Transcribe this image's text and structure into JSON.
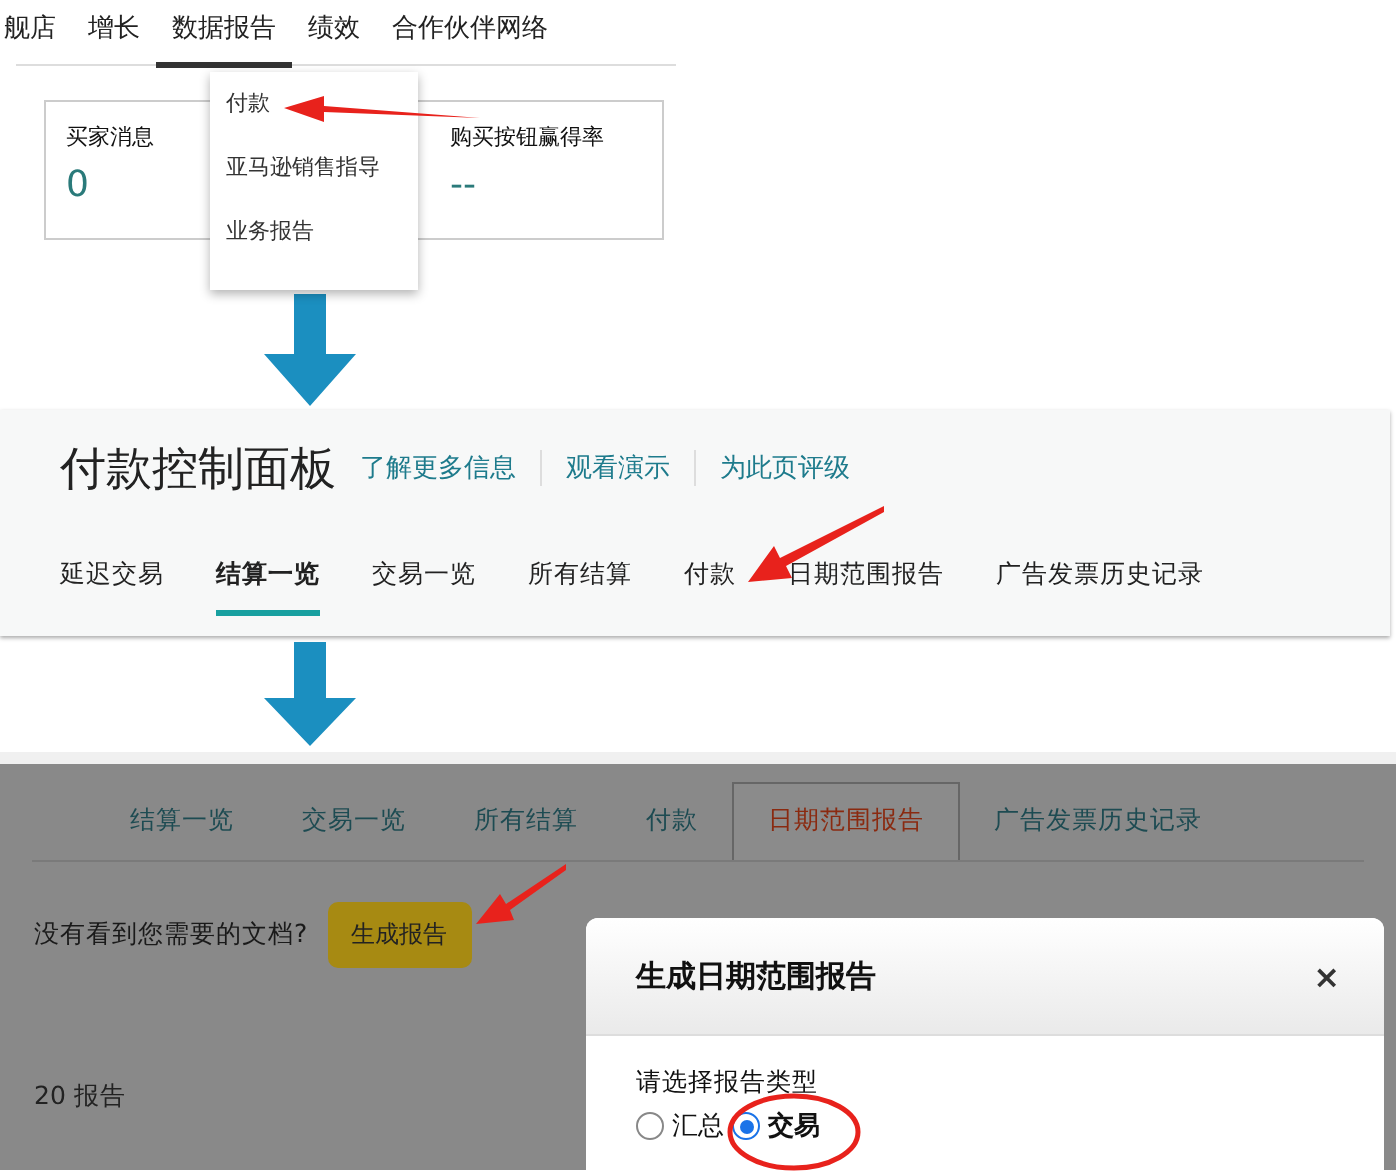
{
  "top_nav": {
    "items": [
      {
        "label": "舰店",
        "selected": false
      },
      {
        "label": "增长",
        "selected": false
      },
      {
        "label": "数据报告",
        "selected": true
      },
      {
        "label": "绩效",
        "selected": false
      },
      {
        "label": "合作伙伴网络",
        "selected": false
      }
    ],
    "dropdown": [
      "付款",
      "亚马逊销售指导",
      "业务报告"
    ],
    "cards": [
      {
        "label": "买家消息",
        "value": "0"
      },
      {
        "label": "购买按钮赢得率",
        "value": "--"
      }
    ]
  },
  "payments_dashboard": {
    "title": "付款控制面板",
    "links": [
      "了解更多信息",
      "观看演示",
      "为此页评级"
    ],
    "tabs": [
      {
        "label": "延迟交易",
        "selected": false
      },
      {
        "label": "结算一览",
        "selected": true
      },
      {
        "label": "交易一览",
        "selected": false
      },
      {
        "label": "所有结算",
        "selected": false
      },
      {
        "label": "付款",
        "selected": false
      },
      {
        "label": "日期范围报告",
        "selected": false
      },
      {
        "label": "广告发票历史记录",
        "selected": false
      }
    ]
  },
  "date_range_page": {
    "tabs": [
      {
        "label": "结算一览",
        "selected": false
      },
      {
        "label": "交易一览",
        "selected": false
      },
      {
        "label": "所有结算",
        "selected": false
      },
      {
        "label": "付款",
        "selected": false
      },
      {
        "label": "日期范围报告",
        "selected": true
      },
      {
        "label": "广告发票历史记录",
        "selected": false
      }
    ],
    "prompt": "没有看到您需要的文档?",
    "generate_button": "生成报告",
    "report_count": "20 报告",
    "dialog": {
      "title": "生成日期范围报告",
      "close": "×",
      "question": "请选择报告类型",
      "options": [
        {
          "label": "汇总",
          "selected": false
        },
        {
          "label": "交易",
          "selected": true
        }
      ]
    }
  }
}
